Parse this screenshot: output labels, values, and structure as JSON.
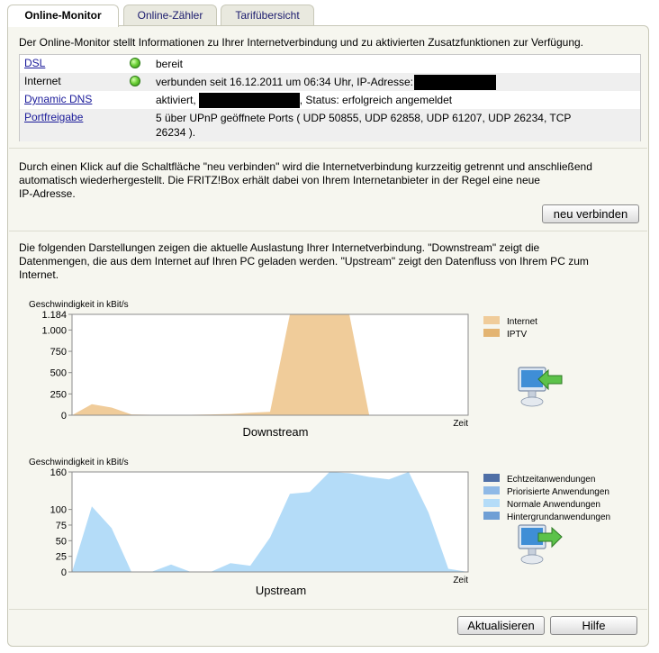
{
  "tabs": [
    {
      "label": "Online-Monitor",
      "active": true
    },
    {
      "label": "Online-Zähler",
      "active": false
    },
    {
      "label": "Tarifübersicht",
      "active": false
    }
  ],
  "intro": "Der Online-Monitor stellt Informationen zu Ihrer Internetverbindung und zu aktivierten Zusatzfunktionen zur Verfügung.",
  "status": {
    "dsl": {
      "name": "DSL",
      "value": "bereit"
    },
    "internet": {
      "name": "Internet",
      "value": "verbunden seit 16.12.2011 um 06:34 Uhr, IP-Adresse:"
    },
    "ddns": {
      "name": "Dynamic DNS",
      "value_pre": "aktiviert,",
      "value_post": ", Status: erfolgreich angemeldet"
    },
    "portfreigabe": {
      "name": "Portfreigabe",
      "value_line1": "5 über UPnP geöffnete Ports ( UDP 50855, UDP 62858, UDP 61207, UDP 26234, TCP",
      "value_line2": "26234 )."
    }
  },
  "reconnect": {
    "text_line1": "Durch einen Klick auf die Schaltfläche \"neu verbinden\" wird die Internetverbindung kurzzeitig getrennt und anschließend",
    "text_line2": "automatisch wiederhergestellt. Die FRITZ!Box erhält dabei von Ihrem Internetanbieter in der Regel eine neue",
    "text_line3": "IP-Adresse.",
    "button": "neu verbinden"
  },
  "usage": {
    "text_line1": "Die folgenden Darstellungen zeigen die aktuelle Auslastung Ihrer Internetverbindung. \"Downstream\" zeigt die",
    "text_line2": "Datenmengen, die aus dem Internet auf Ihren PC geladen werden. \"Upstream\" zeigt den Datenfluss von Ihrem PC zum",
    "text_line3": "Internet."
  },
  "colors": {
    "internet": "#f0cc9a",
    "iptv": "#e3b472",
    "echtzeit": "#4f6fa6",
    "priorisiert": "#8fb9e6",
    "normal": "#b4dcf8",
    "hintergrund": "#6f9fd5",
    "accent_green": "#5cc24a"
  },
  "chart_data": [
    {
      "type": "area",
      "title": "Downstream",
      "ylabel": "Geschwindigkeit in kBit/s",
      "xlabel": "Zeit",
      "ylim": [
        0,
        1184
      ],
      "yticks": [
        0,
        250,
        500,
        750,
        1000,
        1184
      ],
      "ytick_labels": [
        "0",
        "250",
        "500",
        "750",
        "1.000",
        "1.184"
      ],
      "x": [
        0,
        1,
        2,
        3,
        4,
        5,
        6,
        7,
        8,
        9,
        10,
        11,
        12,
        13,
        14,
        15,
        16,
        17,
        18,
        19,
        20
      ],
      "series": [
        {
          "name": "Internet",
          "values": [
            0,
            130,
            90,
            10,
            5,
            5,
            5,
            10,
            15,
            30,
            40,
            1184,
            1184,
            1184,
            1184,
            5,
            5,
            5,
            5,
            5,
            5
          ]
        },
        {
          "name": "IPTV",
          "values": [
            0,
            0,
            0,
            0,
            0,
            0,
            0,
            0,
            0,
            0,
            0,
            0,
            0,
            0,
            0,
            0,
            0,
            0,
            0,
            0,
            0
          ]
        }
      ]
    },
    {
      "type": "area",
      "title": "Upstream",
      "ylabel": "Geschwindigkeit in kBit/s",
      "xlabel": "Zeit",
      "ylim": [
        0,
        160
      ],
      "yticks": [
        0,
        25,
        50,
        75,
        100,
        160
      ],
      "ytick_labels": [
        "0",
        "25",
        "50",
        "75",
        "100",
        "160"
      ],
      "x": [
        0,
        1,
        2,
        3,
        4,
        5,
        6,
        7,
        8,
        9,
        10,
        11,
        12,
        13,
        14,
        15,
        16,
        17,
        18,
        19,
        20
      ],
      "series": [
        {
          "name": "Echtzeitanwendungen",
          "values": [
            0,
            0,
            0,
            0,
            0,
            0,
            0,
            0,
            0,
            0,
            0,
            0,
            0,
            0,
            0,
            0,
            0,
            0,
            0,
            0,
            0
          ]
        },
        {
          "name": "Priorisierte Anwendungen",
          "values": [
            0,
            0,
            0,
            0,
            0,
            0,
            0,
            0,
            0,
            0,
            0,
            0,
            0,
            0,
            0,
            0,
            0,
            0,
            0,
            0,
            0
          ]
        },
        {
          "name": "Normale Anwendungen",
          "values": [
            0,
            105,
            70,
            0,
            0,
            12,
            0,
            0,
            14,
            10,
            55,
            125,
            128,
            160,
            158,
            152,
            148,
            160,
            95,
            5,
            0
          ]
        },
        {
          "name": "Hintergrundanwendungen",
          "values": [
            0,
            0,
            0,
            0,
            0,
            0,
            0,
            0,
            0,
            0,
            0,
            0,
            0,
            0,
            0,
            0,
            0,
            0,
            0,
            0,
            0
          ]
        }
      ]
    }
  ],
  "footer": {
    "refresh": "Aktualisieren",
    "help": "Hilfe"
  }
}
